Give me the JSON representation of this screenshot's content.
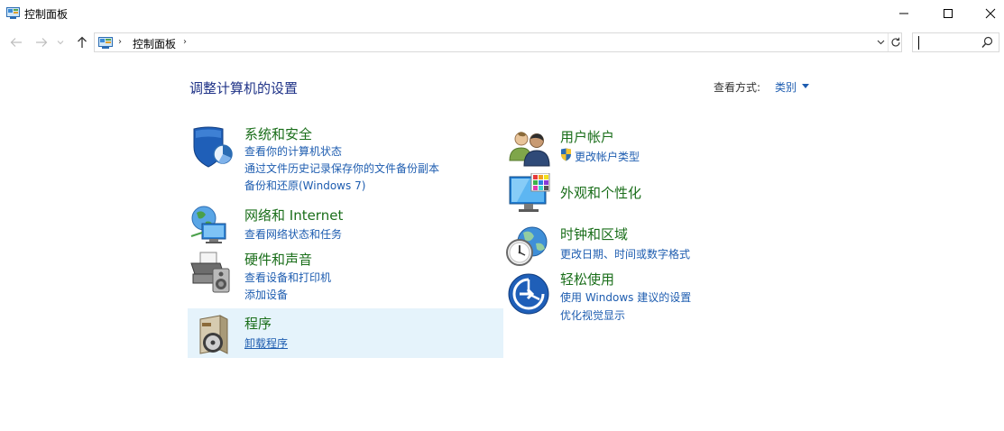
{
  "window": {
    "title": "控制面板"
  },
  "address": {
    "crumb": "控制面板",
    "search_placeholder": ""
  },
  "content": {
    "page_title": "调整计算机的设置",
    "view_by_label": "查看方式:",
    "view_by_value": "类别"
  },
  "categories": {
    "system": {
      "title": "系统和安全",
      "links": [
        "查看你的计算机状态",
        "通过文件历史记录保存你的文件备份副本",
        "备份和还原(Windows 7)"
      ]
    },
    "network": {
      "title": "网络和 Internet",
      "links": [
        "查看网络状态和任务"
      ]
    },
    "hardware": {
      "title": "硬件和声音",
      "links": [
        "查看设备和打印机",
        "添加设备"
      ]
    },
    "programs": {
      "title": "程序",
      "links": [
        "卸载程序"
      ]
    },
    "users": {
      "title": "用户帐户",
      "links": [
        "更改帐户类型"
      ]
    },
    "appearance": {
      "title": "外观和个性化",
      "links": []
    },
    "clock": {
      "title": "时钟和区域",
      "links": [
        "更改日期、时间或数字格式"
      ]
    },
    "ease": {
      "title": "轻松使用",
      "links": [
        "使用 Windows 建议的设置",
        "优化视觉显示"
      ]
    }
  },
  "colors": {
    "title_green": "#1a6e1a",
    "link_blue": "#1e5db0",
    "page_title_blue": "#1e3287",
    "hover_bg": "#e5f3fb"
  }
}
